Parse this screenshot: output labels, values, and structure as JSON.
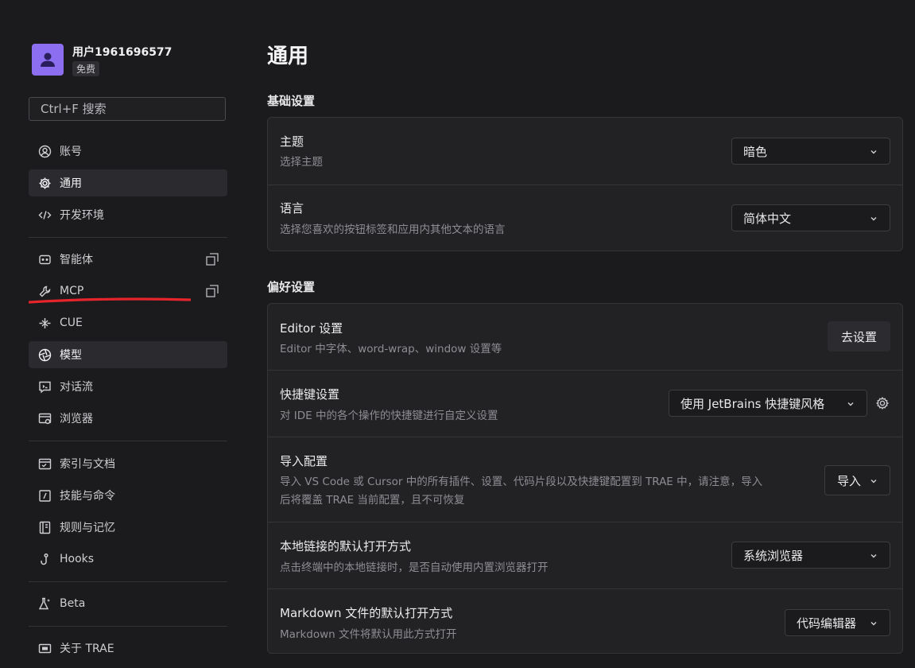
{
  "user": {
    "name": "用户1961696577",
    "plan": "免费"
  },
  "search": {
    "placeholder": "Ctrl+F 搜索"
  },
  "sidebar": {
    "items": [
      {
        "label": "账号",
        "icon": "user-circle-icon"
      },
      {
        "label": "通用",
        "icon": "gear-icon"
      },
      {
        "label": "开发环境",
        "icon": "code-icon"
      },
      {
        "label": "智能体",
        "icon": "robot-icon"
      },
      {
        "label": "MCP",
        "icon": "wrench-icon"
      },
      {
        "label": "CUE",
        "icon": "cue-icon"
      },
      {
        "label": "模型",
        "icon": "aperture-icon"
      },
      {
        "label": "对话流",
        "icon": "chat-flow-icon"
      },
      {
        "label": "浏览器",
        "icon": "browser-icon"
      },
      {
        "label": "索引与文档",
        "icon": "index-doc-icon"
      },
      {
        "label": "技能与命令",
        "icon": "skill-command-icon"
      },
      {
        "label": "规则与记忆",
        "icon": "rules-memory-icon"
      },
      {
        "label": "Hooks",
        "icon": "hook-icon"
      },
      {
        "label": "Beta",
        "icon": "flask-icon"
      },
      {
        "label": "关于 TRAE",
        "icon": "about-icon"
      }
    ]
  },
  "main": {
    "title": "通用",
    "basic": {
      "title": "基础设置",
      "theme": {
        "title": "主题",
        "desc": "选择主题",
        "value": "暗色"
      },
      "language": {
        "title": "语言",
        "desc": "选择您喜欢的按钮标签和应用内其他文本的语言",
        "value": "简体中文"
      }
    },
    "prefs": {
      "title": "偏好设置",
      "editor": {
        "title": "Editor 设置",
        "desc": "Editor 中字体、word-wrap、window 设置等",
        "button": "去设置"
      },
      "shortcut": {
        "title": "快捷键设置",
        "desc": "对 IDE 中的各个操作的快捷键进行自定义设置",
        "value": "使用 JetBrains 快捷键风格"
      },
      "import": {
        "title": "导入配置",
        "desc_line1": "导入 VS Code 或 Cursor 中的所有插件、设置、代码片段以及快捷键配置到 TRAE 中，请注意，导入",
        "desc_line2": "后将覆盖 TRAE 当前配置，且不可恢复",
        "button": "导入"
      },
      "local_link": {
        "title": "本地链接的默认打开方式",
        "desc": "点击终端中的本地链接时，是否自动使用内置浏览器打开",
        "value": "系统浏览器"
      },
      "markdown": {
        "title": "Markdown 文件的默认打开方式",
        "desc": "Markdown 文件将默认用此方式打开",
        "value": "代码编辑器"
      }
    }
  },
  "colors": {
    "accent_underline": "#e5242b",
    "avatar": "#8b6ff0",
    "background": "#1b1b1d"
  }
}
